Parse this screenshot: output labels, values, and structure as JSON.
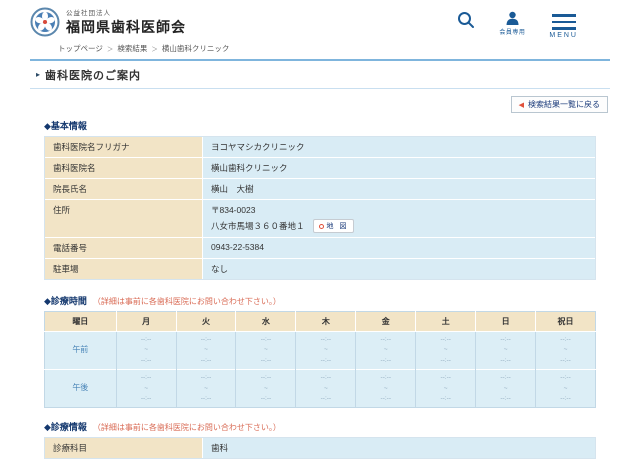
{
  "header": {
    "org_type": "公益社団法人",
    "org_name": "福岡県歯科医師会",
    "members_label": "会員専用",
    "menu_label": "MENU"
  },
  "breadcrumb": {
    "separator": "＞",
    "items": [
      "トップページ",
      "検索結果",
      "横山歯科クリニック"
    ]
  },
  "page": {
    "title": "歯科医院のご案内",
    "title_arrow": "▸",
    "back_button_label": "検索結果一覧に戻る",
    "back_button_arrow": "◀"
  },
  "basic_info": {
    "heading": "◆基本情報",
    "rows": [
      {
        "label": "歯科医院名フリガナ",
        "value": "ヨコヤマシカクリニック"
      },
      {
        "label": "歯科医院名",
        "value": "横山歯科クリニック"
      },
      {
        "label": "院長氏名",
        "value": "横山　大樹"
      },
      {
        "label": "住所",
        "value": "〒834-0023",
        "value2": "八女市馬場３６０番地１",
        "map_label": "地 図"
      },
      {
        "label": "電話番号",
        "value": "0943-22-5384"
      },
      {
        "label": "駐車場",
        "value": "なし"
      }
    ]
  },
  "hours": {
    "heading": "◆診療時間",
    "note": "（詳細は事前に各歯科医院にお問い合わせ下さい。）",
    "columns": [
      "曜日",
      "月",
      "火",
      "水",
      "木",
      "金",
      "土",
      "日",
      "祝日"
    ],
    "rows": [
      {
        "label": "午前",
        "times": [
          "--:--",
          "~",
          "--:--"
        ]
      },
      {
        "label": "午後",
        "times": [
          "--:--",
          "~",
          "--:--"
        ]
      }
    ]
  },
  "treatment_info": {
    "heading": "◆診療情報",
    "note": "（詳細は事前に各歯科医院にお問い合わせ下さい。）",
    "rows": [
      {
        "label": "診療科目",
        "value": "歯科"
      }
    ]
  },
  "colors": {
    "accent_navy": "#1a5a96",
    "heading_navy": "#14386e",
    "label_beige": "#f2e4c6",
    "value_blue": "#d9ecf5",
    "note_red": "#d96b55",
    "arrow_red": "#e0503a"
  }
}
